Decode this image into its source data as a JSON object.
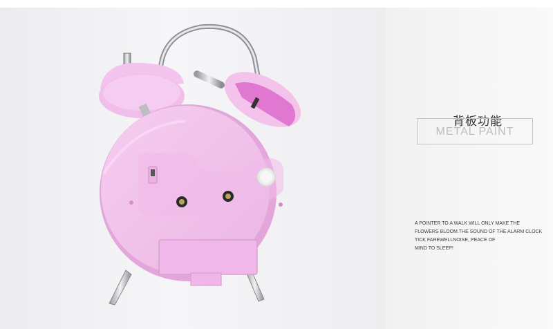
{
  "heading": {
    "chinese": "背板功能",
    "english": "METAL PAINT"
  },
  "description": {
    "lines": [
      "A POINTER TO A WALK WILL ONLY MAKE THE",
      "FLOWERS BLOOM.THE SOUND OF THE ALARM CLOCK",
      "TICK FAREWELLNOISE, PEACE OF",
      "MIND TO SLEEP!"
    ]
  },
  "colors": {
    "clock_body": "#f3c2ec",
    "clock_shadow": "#e2a6da",
    "bell_stripe": "#e078d2",
    "metal": "#c9c9cc",
    "background": "#f2f2f4"
  }
}
